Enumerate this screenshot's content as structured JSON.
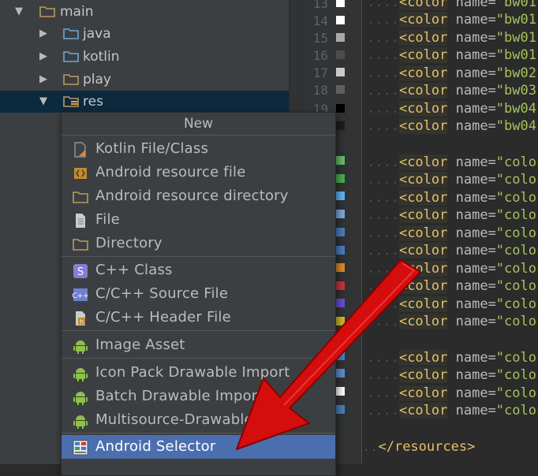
{
  "project_tree": {
    "items": [
      {
        "label": "main",
        "expanded": true,
        "icon": "folder-icon"
      },
      {
        "label": "java",
        "expanded": false,
        "icon": "source-folder-icon"
      },
      {
        "label": "kotlin",
        "expanded": false,
        "icon": "source-folder-icon"
      },
      {
        "label": "play",
        "expanded": false,
        "icon": "folder-icon"
      },
      {
        "label": "res",
        "expanded": true,
        "selected": true,
        "icon": "resource-folder-icon"
      }
    ]
  },
  "editor": {
    "line_numbers": [
      "13",
      "14",
      "15",
      "16",
      "17",
      "18",
      "19"
    ],
    "color_swatches": [
      "#ffffff",
      "#ffffff",
      "#a8a8a8",
      "#4c4c4c",
      "#c9c9c9",
      "#5f5f5f",
      "#000000",
      "#1e1e1e",
      "#6abf69",
      "#4caf50",
      "#64b5f6",
      "#7eaadc",
      "#4a7fc1",
      "#4a7fc1",
      "#e08a2a",
      "#cc3340",
      "#6a4fcf",
      "#d6b82a",
      "#4a7fc1",
      "#5e8fcf",
      "#ffffff",
      "#4a7fc1"
    ],
    "lines": [
      {
        "tag": "<color",
        "attr": " name=",
        "val": "\"bw01"
      },
      {
        "tag": "<color",
        "attr": " name=",
        "val": "\"bw01"
      },
      {
        "tag": "<color",
        "attr": " name=",
        "val": "\"bw01"
      },
      {
        "tag": "<color",
        "attr": " name=",
        "val": "\"bw01"
      },
      {
        "tag": "<color",
        "attr": " name=",
        "val": "\"bw02"
      },
      {
        "tag": "<color",
        "attr": " name=",
        "val": "\"bw03"
      },
      {
        "tag": "<color",
        "attr": " name=",
        "val": "\"bw04"
      },
      {
        "tag": "<color",
        "attr": " name=",
        "val": "\"bw04"
      },
      {
        "tag": "<color",
        "attr": " name=",
        "val": "\"colo"
      },
      {
        "tag": "<color",
        "attr": " name=",
        "val": "\"colo"
      },
      {
        "tag": "<color",
        "attr": " name=",
        "val": "\"colo"
      },
      {
        "tag": "<color",
        "attr": " name=",
        "val": "\"colo"
      },
      {
        "tag": "<color",
        "attr": " name=",
        "val": "\"colo"
      },
      {
        "tag": "<color",
        "attr": " name=",
        "val": "\"colo"
      },
      {
        "tag": "<color",
        "attr": " name=",
        "val": "\"colo"
      },
      {
        "tag": "<color",
        "attr": " name=",
        "val": "\"colo"
      },
      {
        "tag": "<color",
        "attr": " name=",
        "val": "\"colo"
      },
      {
        "tag": "<color",
        "attr": " name=",
        "val": "\"colo"
      },
      {
        "tag": "<color",
        "attr": " name=",
        "val": "\"colo"
      },
      {
        "tag": "<color",
        "attr": " name=",
        "val": "\"colo"
      },
      {
        "tag": "<color",
        "attr": " name=",
        "val": "\"colo"
      },
      {
        "tag": "<color",
        "attr": " name=",
        "val": "\"colo"
      }
    ],
    "closing_tag": "</resources>",
    "indent_dots": "....",
    "short_dots": ".."
  },
  "context_menu": {
    "title": "New",
    "items": [
      {
        "label": "Kotlin File/Class",
        "icon": "kotlin-file-icon"
      },
      {
        "label": "Android resource file",
        "icon": "resource-file-icon"
      },
      {
        "label": "Android resource directory",
        "icon": "folder-icon"
      },
      {
        "label": "File",
        "icon": "file-icon"
      },
      {
        "label": "Directory",
        "icon": "folder-icon"
      },
      {
        "label": "C++ Class",
        "icon": "cpp-class-icon"
      },
      {
        "label": "C/C++ Source File",
        "icon": "cpp-source-icon"
      },
      {
        "label": "C/C++ Header File",
        "icon": "cpp-header-icon"
      },
      {
        "label": "Image Asset",
        "icon": "android-icon"
      },
      {
        "label": "Icon Pack Drawable Import",
        "icon": "android-icon"
      },
      {
        "label": "Batch Drawable Import",
        "icon": "android-icon"
      },
      {
        "label": "Multisource-Drawable",
        "icon": "android-icon"
      },
      {
        "label": "Android Selector",
        "icon": "selector-icon",
        "highlighted": true
      }
    ]
  },
  "annotation": {
    "icon": "red-arrow-icon",
    "color": "#e01010"
  }
}
